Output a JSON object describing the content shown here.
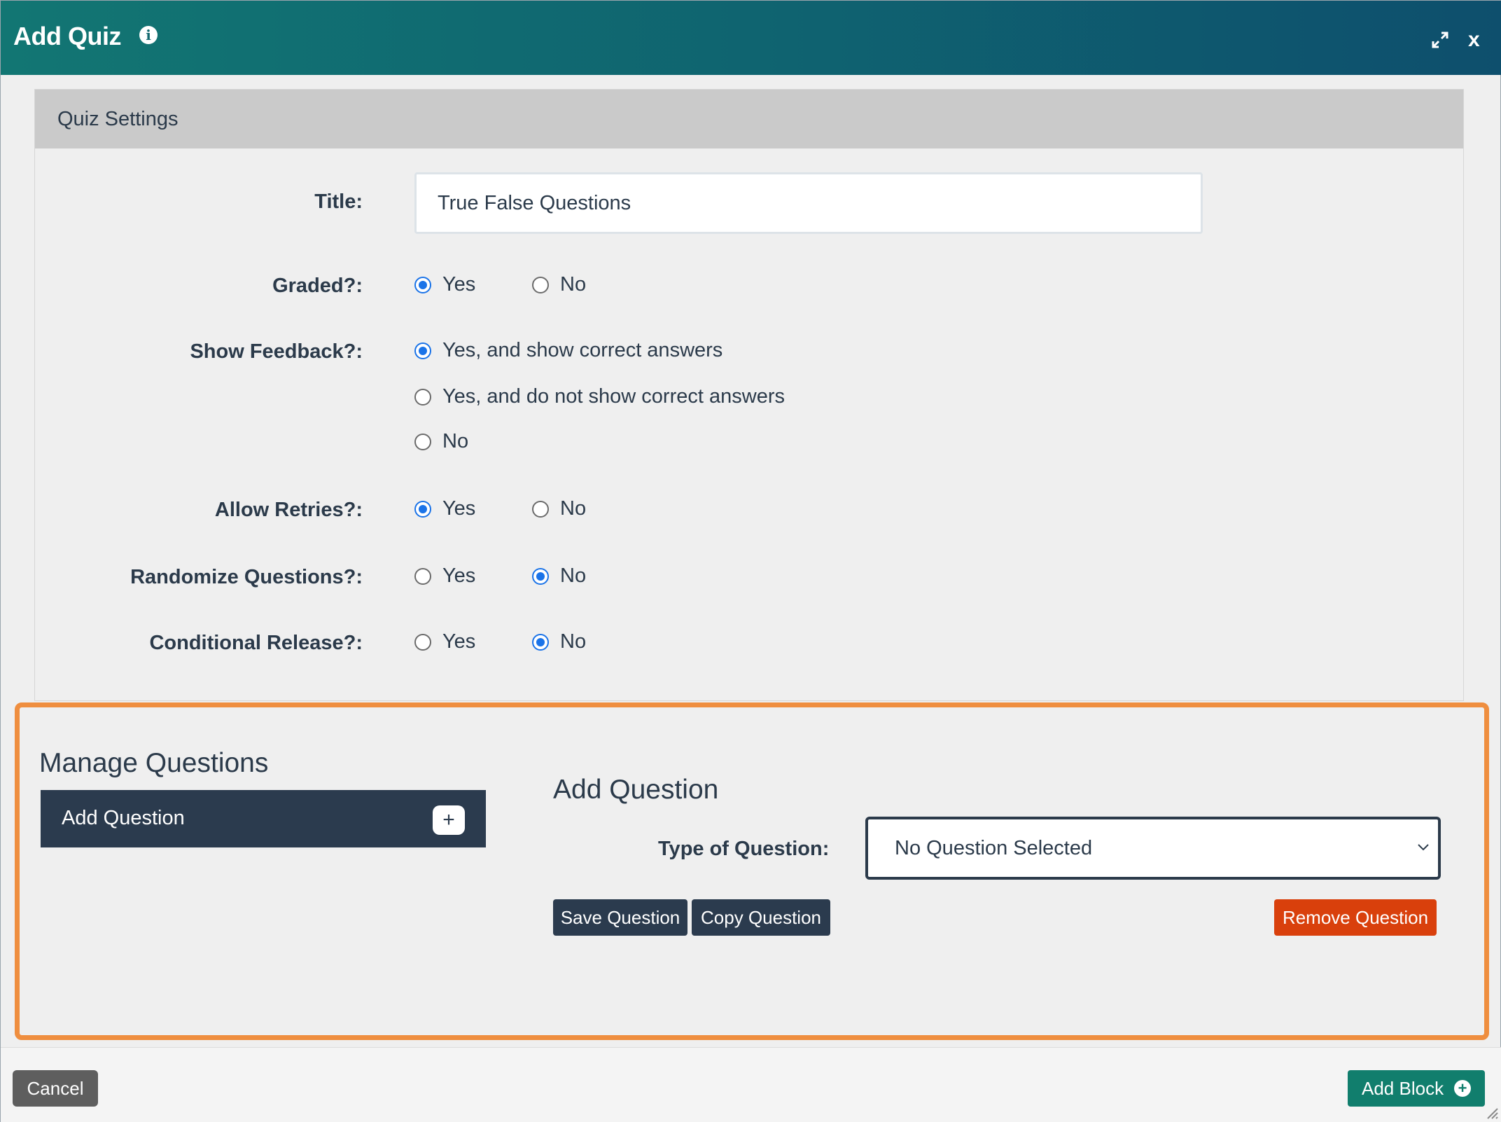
{
  "window": {
    "title": "Add Quiz",
    "close_label": "x",
    "icons": {
      "info": "info-icon",
      "expand": "expand-icon",
      "close": "close-icon"
    }
  },
  "settings": {
    "header": "Quiz Settings",
    "title_label": "Title:",
    "title_value": "True False Questions",
    "graded": {
      "label": "Graded?:",
      "options": [
        "Yes",
        "No"
      ],
      "selected": "Yes"
    },
    "show_feedback": {
      "label": "Show Feedback?:",
      "options": [
        "Yes, and show correct answers",
        "Yes, and do not show correct answers",
        "No"
      ],
      "selected": "Yes, and show correct answers"
    },
    "allow_retries": {
      "label": "Allow Retries?:",
      "options": [
        "Yes",
        "No"
      ],
      "selected": "Yes"
    },
    "randomize_questions": {
      "label": "Randomize Questions?:",
      "options": [
        "Yes",
        "No"
      ],
      "selected": "No"
    },
    "conditional_release": {
      "label": "Conditional Release?:",
      "options": [
        "Yes",
        "No"
      ],
      "selected": "No"
    }
  },
  "manage": {
    "title": "Manage Questions",
    "add_question_label": "Add Question",
    "add_question_icon": "plus-icon",
    "highlight_color": "#ef8e3f"
  },
  "add_question": {
    "title": "Add Question",
    "type_label": "Type of Question:",
    "type_value": "No Question Selected",
    "save_label": "Save Question",
    "copy_label": "Copy Question",
    "remove_label": "Remove Question"
  },
  "footer": {
    "cancel_label": "Cancel",
    "add_block_label": "Add Block",
    "add_block_icon": "plus-circle-icon"
  }
}
